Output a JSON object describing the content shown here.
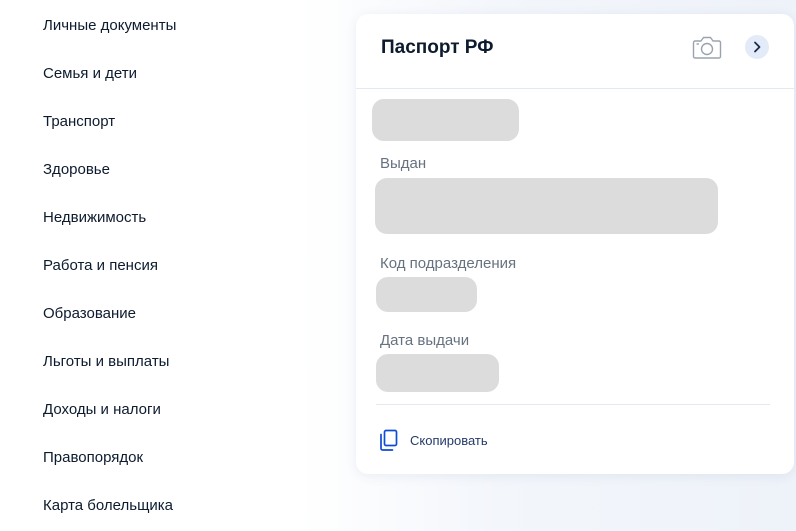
{
  "sidebar": {
    "items": [
      {
        "label": "Личные документы"
      },
      {
        "label": "Семья и дети"
      },
      {
        "label": "Транспорт"
      },
      {
        "label": "Здоровье"
      },
      {
        "label": "Недвижимость"
      },
      {
        "label": "Работа и пенсия"
      },
      {
        "label": "Образование"
      },
      {
        "label": "Льготы и выплаты"
      },
      {
        "label": "Доходы и налоги"
      },
      {
        "label": "Правопорядок"
      },
      {
        "label": "Карта болельщика"
      }
    ]
  },
  "card": {
    "title": "Паспорт РФ",
    "icons": {
      "camera": "camera-icon",
      "next": "chevron-right-icon",
      "copy": "copy-icon"
    },
    "fields": {
      "issued_label": "Выдан",
      "code_label": "Код подразделения",
      "date_label": "Дата выдачи"
    },
    "copy_label": "Скопировать"
  },
  "colors": {
    "text": "#0d1b2e",
    "label": "#66727f",
    "skeleton": "#dcdcdc",
    "accent_bg": "#e3ebf8"
  }
}
